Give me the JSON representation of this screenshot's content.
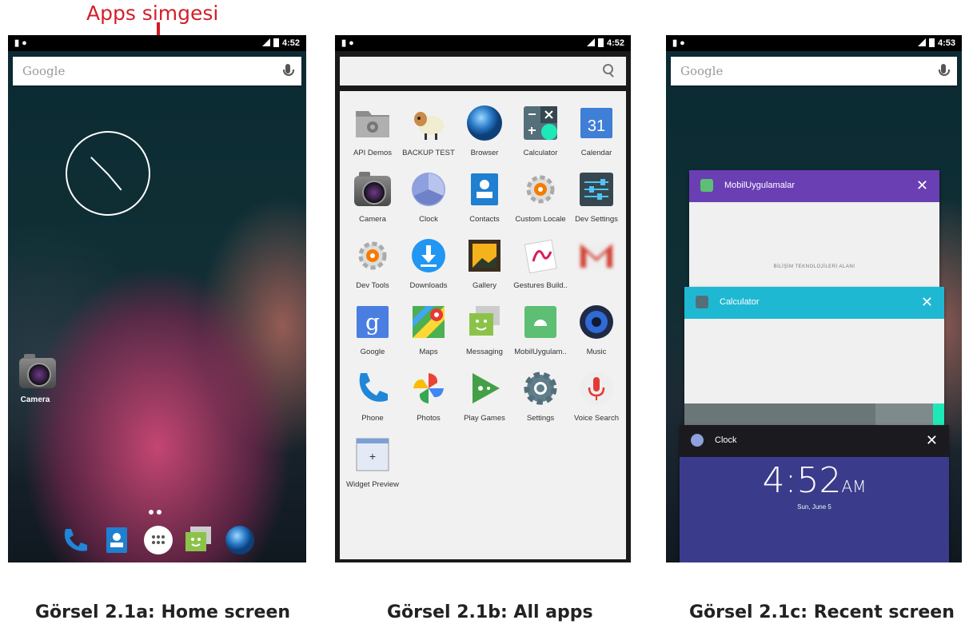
{
  "annotation": {
    "label": "Apps simgesi"
  },
  "captions": [
    "Görsel 2.1a: Home screen",
    "Görsel 2.1b: All apps",
    "Görsel 2.1c: Recent screen"
  ],
  "home": {
    "status_time": "4:52",
    "search_placeholder": "Google",
    "desktop_app": "Camera"
  },
  "all_apps": {
    "status_time": "4:52",
    "apps": [
      "API Demos",
      "BACKUP TEST",
      "Browser",
      "Calculator",
      "Calendar",
      "Camera",
      "Clock",
      "Contacts",
      "Custom Locale",
      "Dev Settings",
      "Dev Tools",
      "Downloads",
      "Gallery",
      "Gestures Build..",
      "",
      "Google",
      "Maps",
      "Messaging",
      "MobilUygulam..",
      "Music",
      "Phone",
      "Photos",
      "Play Games",
      "Settings",
      "Voice Search",
      "Widget Preview"
    ],
    "calendar_day": "31"
  },
  "recent": {
    "status_time": "4:53",
    "search_placeholder": "Google",
    "cards": [
      {
        "title": "MobilUygulamalar",
        "body": "BİLİŞİM TEKNOLOJİLERİ ALANI",
        "color": "#6a3fb3"
      },
      {
        "title": "Calculator",
        "color": "#1fb8d3"
      },
      {
        "title": "Clock",
        "time": "4:52",
        "ampm": "AM",
        "date": "Sun, June 5",
        "color": "#1b1b1f"
      }
    ]
  },
  "colors": {
    "accent": "#d41a23"
  }
}
